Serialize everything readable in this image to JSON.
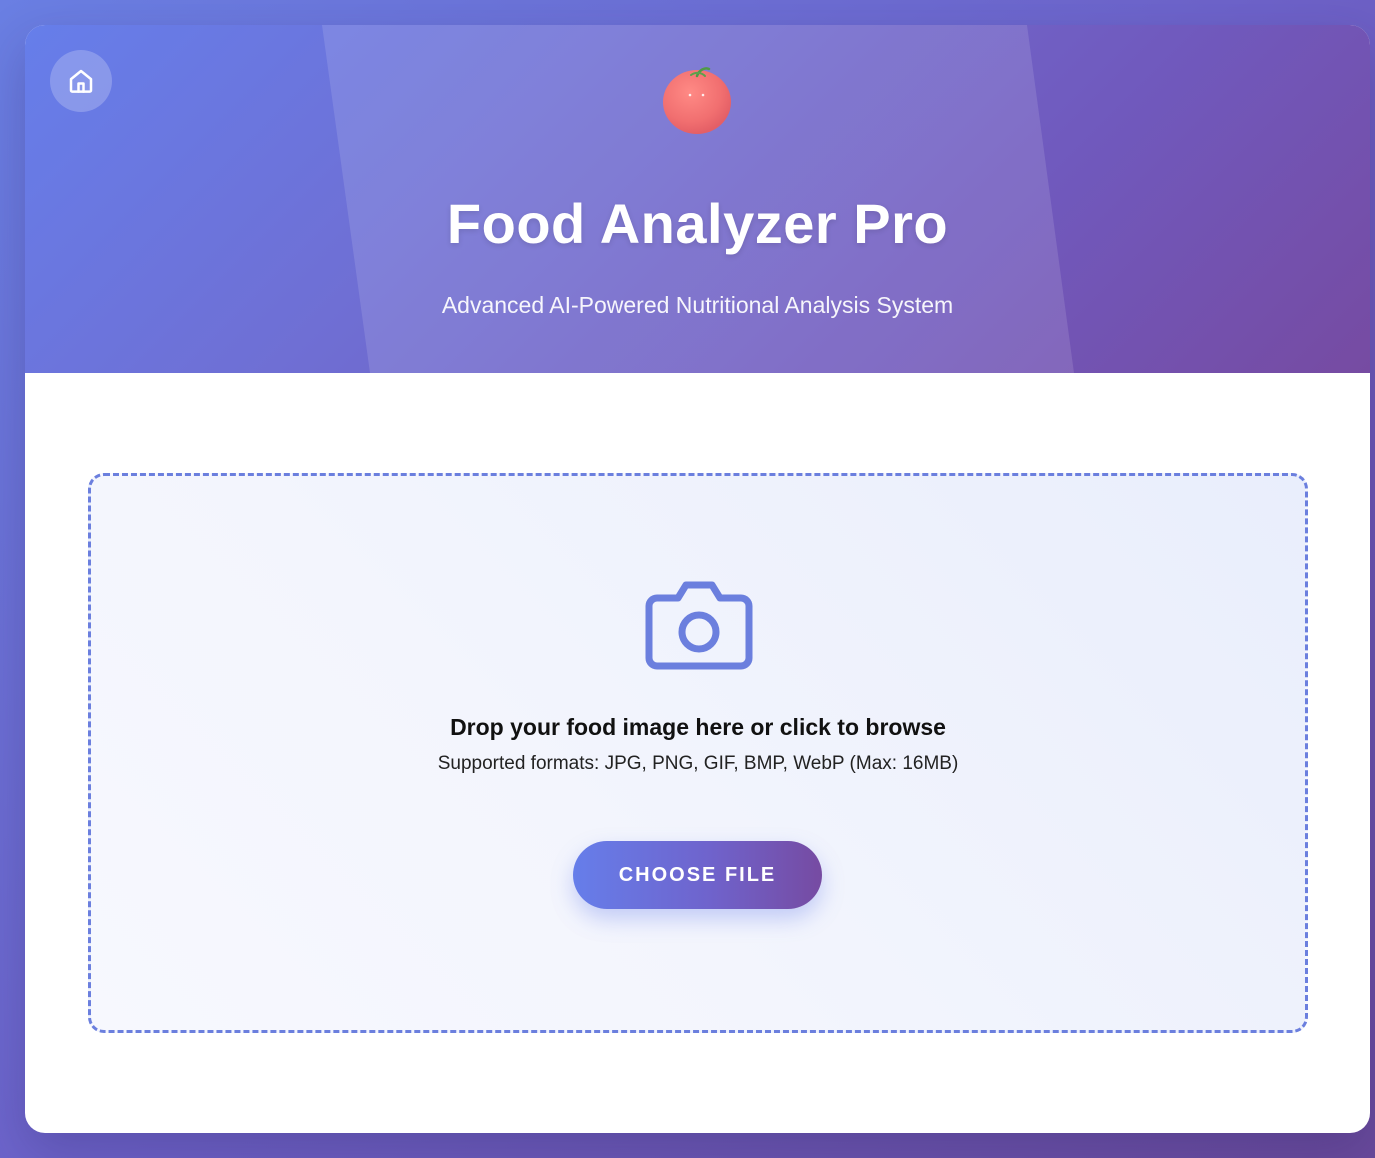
{
  "header": {
    "title": "Food Analyzer Pro",
    "subtitle": "Advanced AI-Powered Nutritional Analysis System",
    "home_icon": "home-icon",
    "logo_icon": "tomato-logo-icon"
  },
  "upload": {
    "icon": "camera-icon",
    "headline": "Drop your food image here or click to browse",
    "formats": "Supported formats: JPG, PNG, GIF, BMP, WebP (Max: 16MB)",
    "button_label": "CHOOSE FILE"
  },
  "colors": {
    "gradient_start": "#667eea",
    "gradient_end": "#764ba2",
    "accent": "#6b7fde",
    "logo_red": "#f26b6b"
  }
}
